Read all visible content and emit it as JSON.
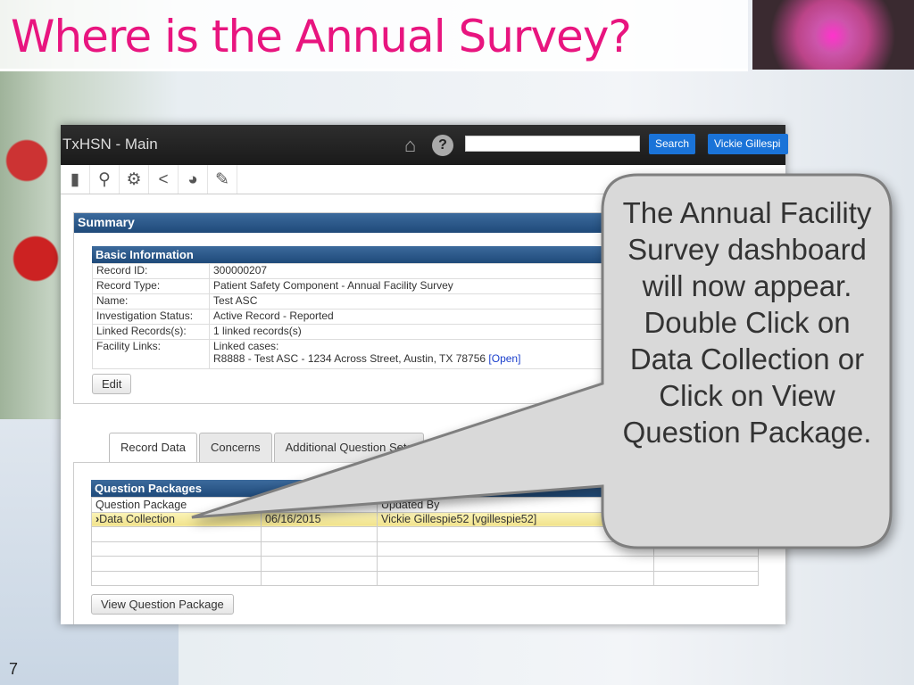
{
  "slide": {
    "title": "Where is the Annual Survey?",
    "page_number": "7"
  },
  "app": {
    "title": "TxHSN - Main",
    "search_placeholder": "",
    "search_button": "Search",
    "user_button": "Vickie Gillespi",
    "toolbar": [
      "file-icon",
      "search-icon",
      "gears-icon",
      "share-icon",
      "chart-icon",
      "pin-icon"
    ]
  },
  "summary": {
    "title": "Summary",
    "section": "Basic Information",
    "rows": [
      {
        "label": "Record ID:",
        "value": "300000207"
      },
      {
        "label": "Record Type:",
        "value": "Patient Safety Component - Annual Facility Survey"
      },
      {
        "label": "Name:",
        "value": "Test ASC"
      },
      {
        "label": "Investigation Status:",
        "value": "Active Record - Reported"
      },
      {
        "label": "Linked Records(s):",
        "value": "1 linked records(s)"
      }
    ],
    "facility_links_label": "Facility Links:",
    "linked_cases": "Linked cases:",
    "case": "R8888 - Test ASC - 1234 Across Street, Austin, TX 78756",
    "open_link": "[Open]",
    "edit_button": "Edit"
  },
  "tabs": [
    {
      "label": "Record Data",
      "active": true
    },
    {
      "label": "Concerns"
    },
    {
      "label": "Additional Question Sets"
    }
  ],
  "question_packages": {
    "title": "Question Packages",
    "headers": [
      "Question Package",
      "",
      "Updated By",
      ""
    ],
    "rows": [
      [
        "Data Collection",
        "06/16/2015",
        "Vickie Gillespie52 [vgillespie52]",
        ""
      ]
    ],
    "view_button": "View Question Package"
  },
  "callout": {
    "text": "The Annual Facility Survey dashboard will now appear. Double Click on Data Collection or Click on View Question Package."
  },
  "colors": {
    "title": "#e8157f",
    "header_blue": "#1f4a7a",
    "button_blue": "#1a73d8",
    "selected_row": "#f5e9a0"
  }
}
